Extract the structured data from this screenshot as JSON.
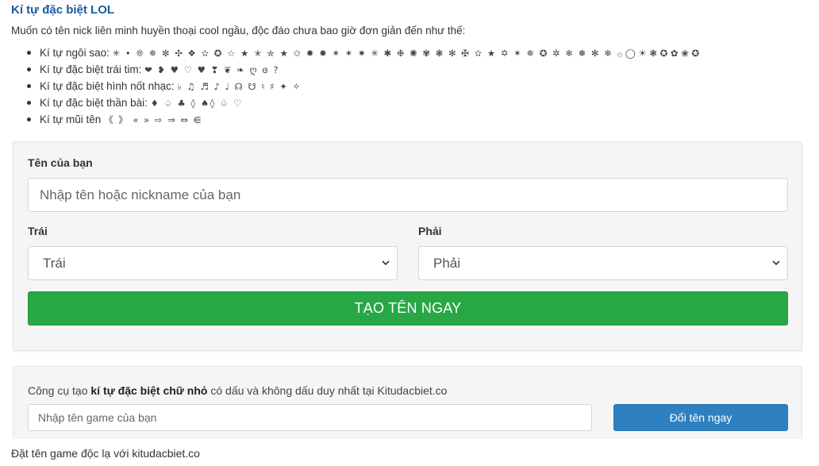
{
  "header": {
    "title": "Kí tự đặc biệt LOL",
    "intro": "Muốn có tên nick liên minh huyền thoại cool ngầu, độc đáo chưa bao giờ đơn giản đến như thế:"
  },
  "symbol_list": [
    {
      "label": "Kí tự ngôi sao: ",
      "chars": "✳ • ❊ ✵ ✼ ✣ ❖ ✫ ✪ ☆ ★ ✭ ✮ ★ ✩ ✸ ✸ ✶ ✶ ✷ ✳ ✱ ❉ ✺ ✾ ❃ ✻ ✠ ✫ ★ ✡ ✶ ✵ ✪ ✲ ❄ ❅ ✻ ❄ ۞ ◯ ☀ ❃ ✪ ✿ ❀ ✪"
    },
    {
      "label": "Kí tự đặc biệt trái tim: ",
      "chars": "❤ ❥ ♥ ♡ ♥ ❣ ❦ ❧ ღ ɞ ?"
    },
    {
      "label": "Kí tự đặc biệt hình nốt nhạc: ",
      "chars": "♭ ♫ ♬ ♪ ♩ ☊ ☋ ♮ ♯ ✦ ✧"
    },
    {
      "label": "Kí tự đặc biệt thần bài: ",
      "chars": "♦ ♤ ♣ ◊ ♠◊ ♧ ♡"
    },
    {
      "label": "Kí tự mũi tên ",
      "chars": "《 》 « » ⇨ ⇒ ⇔ ⋹"
    }
  ],
  "form": {
    "name_label": "Tên của bạn",
    "name_placeholder": "Nhập tên hoặc nickname của bạn",
    "left_label": "Trái",
    "left_value": "Trái",
    "right_label": "Phải",
    "right_value": "Phải",
    "create_button": "TẠO TÊN NGAY"
  },
  "tool": {
    "desc_prefix": "Công cụ tạo ",
    "desc_bold": "kí tự đặc biệt chữ nhỏ",
    "desc_suffix": " có dấu và không dấu duy nhất tại Kitudacbiet.co",
    "game_placeholder": "Nhập tên game của bạn",
    "rename_button": "Đổi tên ngay"
  },
  "footer": {
    "text": "Đặt tên game độc lạ với kitudacbiet.co"
  },
  "colors": {
    "title": "#1a5aa0",
    "create_button": "#28a745",
    "rename_button": "#2f80c0",
    "panel_bg": "#f5f5f5"
  }
}
